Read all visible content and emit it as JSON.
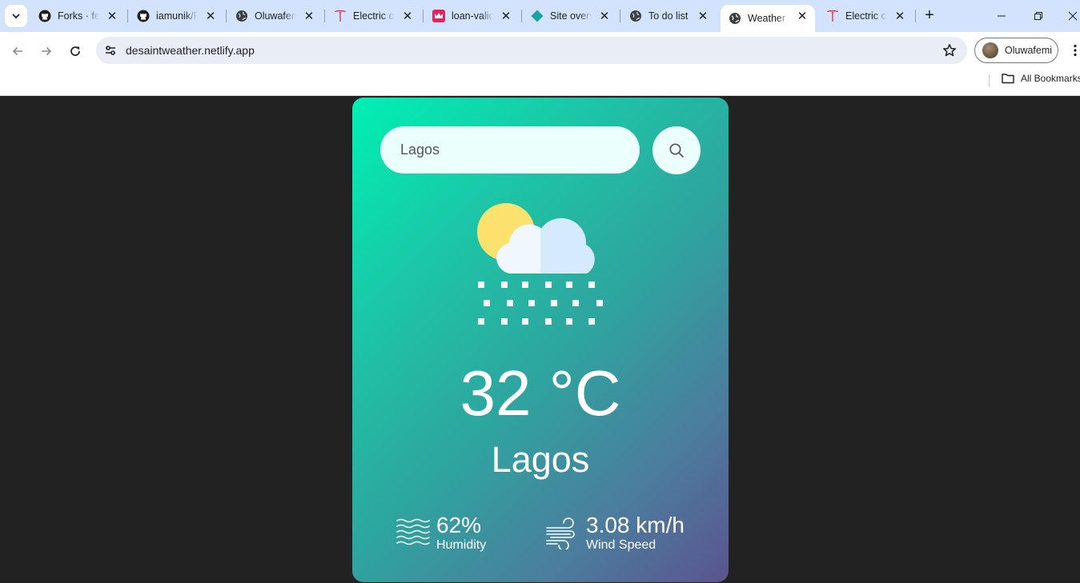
{
  "browser": {
    "tabs": [
      {
        "title": "Forks · fen",
        "favicon": "github-icon"
      },
      {
        "title": "iamunik/F",
        "favicon": "github-icon"
      },
      {
        "title": "Oluwafem",
        "favicon": "globe-icon"
      },
      {
        "title": "Electric ca",
        "favicon": "tesla-icon"
      },
      {
        "title": "loan-valic",
        "favicon": "crown-icon"
      },
      {
        "title": "Site overv",
        "favicon": "netlify-icon"
      },
      {
        "title": "To do list",
        "favicon": "globe-icon"
      },
      {
        "title": "Weather A",
        "favicon": "globe-icon",
        "active": true
      },
      {
        "title": "Electric ca",
        "favicon": "tesla-icon"
      }
    ],
    "address": "desaintweather.netlify.app",
    "profile_name": "Oluwafemi",
    "bookmarks_label": "All Bookmarks"
  },
  "weather": {
    "search_value": "Lagos",
    "condition_icon": "cloud-sun-snow-icon",
    "temperature": "32 °C",
    "city": "Lagos",
    "humidity": {
      "value": "62%",
      "label": "Humidity"
    },
    "wind": {
      "value": "3.08 km/h",
      "label": "Wind Speed"
    }
  },
  "colors": {
    "card_gradient_start": "#00f0b4",
    "card_gradient_end": "#5b548f",
    "page_bg": "#222222",
    "tab_strip": "#d3e3fd",
    "sun": "#fbe16e"
  }
}
